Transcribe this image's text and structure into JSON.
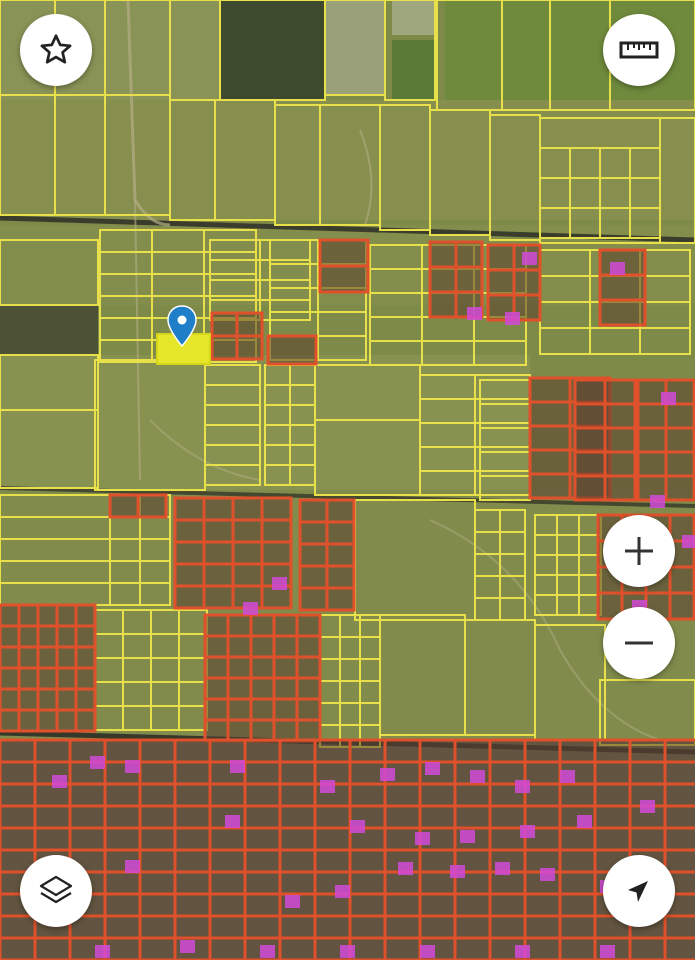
{
  "map": {
    "view": "satellite",
    "overlay": "cadastral-parcels",
    "colors": {
      "parcel_line": "#e8e04a",
      "built_parcel_line": "#e0502a",
      "building": "#d24ad8",
      "selected_parcel_fill": "#e6e62a",
      "marker": "#1e7fc8",
      "road": "#3d3f2a"
    }
  },
  "controls": {
    "favorite_icon": "star-icon",
    "ruler_icon": "ruler-icon",
    "zoom_in_icon": "plus-icon",
    "zoom_out_icon": "minus-icon",
    "layers_icon": "layers-icon",
    "locate_icon": "navigation-arrow-icon"
  }
}
